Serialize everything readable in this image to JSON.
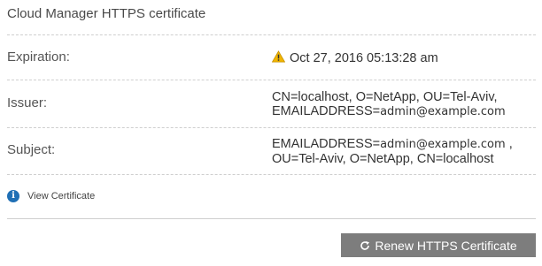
{
  "panel": {
    "title": "Cloud Manager HTTPS certificate"
  },
  "rows": {
    "expiration": {
      "label": "Expiration:",
      "value": "Oct 27, 2016 05:13:28 am",
      "icon": "warning-icon"
    },
    "issuer": {
      "label": "Issuer:",
      "line1": "CN=localhost, O=NetApp, OU=Tel-Aviv,",
      "line2_prefix": "EMAILADDRESS=",
      "line2_email": "admin@example.com"
    },
    "subject": {
      "label": "Subject:",
      "line1_prefix": "EMAILADDRESS=",
      "line1_email": "admin@example.com",
      "line1_suffix": " ,",
      "line2": "OU=Tel-Aviv, O=NetApp, CN=localhost"
    }
  },
  "view_certificate": {
    "label": "View Certificate",
    "icon": "info-icon"
  },
  "renew_button": {
    "label": "Renew HTTPS Certificate",
    "icon": "refresh-icon"
  },
  "colors": {
    "accent_info": "#1f6fb5",
    "warning": "#f0b400",
    "button_bg": "#7d7d7d"
  }
}
